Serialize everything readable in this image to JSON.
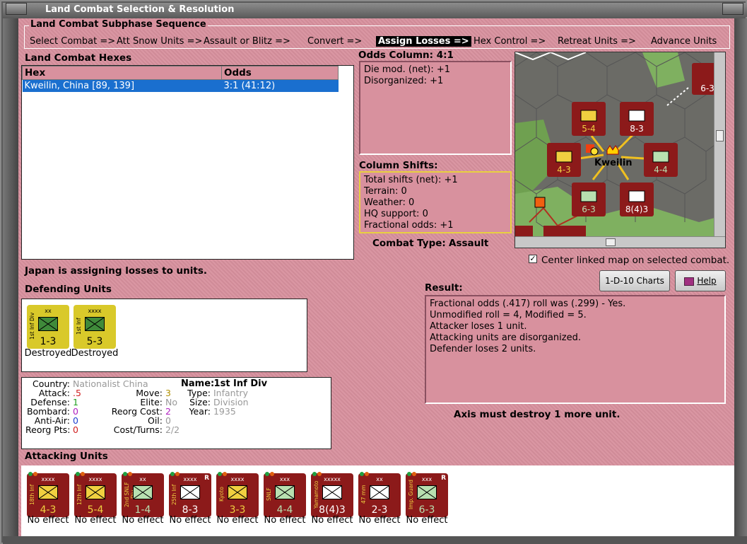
{
  "window": {
    "title": "Land Combat Selection & Resolution"
  },
  "sequence": {
    "label": "Land Combat Subphase Sequence",
    "steps": [
      "Select Combat =>",
      "Att Snow Units =>",
      "Assault or Blitz =>",
      "Convert =>",
      "Assign Losses =>",
      "Hex Control =>",
      "Retreat Units =>",
      "Advance Units"
    ],
    "active_index": 4
  },
  "hexes": {
    "label": "Land Combat Hexes",
    "columns": [
      "Hex",
      "Odds"
    ],
    "rows": [
      {
        "hex": "Kweilin, China [89, 139]",
        "odds": "3:1 (41:12)"
      }
    ]
  },
  "odds_column": {
    "label": "Odds Column: 4:1",
    "lines": [
      "Die mod. (net): +1",
      "Disorganized: +1"
    ]
  },
  "column_shifts": {
    "label": "Column Shifts:",
    "lines": [
      "Total shifts (net): +1",
      "Terrain: 0",
      "Weather: 0",
      "HQ support: 0",
      "Fractional odds: +1"
    ]
  },
  "combat_type": {
    "label": "Combat Type:",
    "value": "Assault"
  },
  "map": {
    "city": "Kweilin",
    "center_checkbox": {
      "label": "Center linked map on selected combat.",
      "checked": true
    }
  },
  "status_msg": "Japan is assigning losses to units.",
  "defending": {
    "label": "Defending Units",
    "units": [
      {
        "name": "1st Inf Div",
        "size": "xx",
        "strength": "1-3",
        "caption": "Destroyed",
        "bg": "#d9c92a",
        "box": "#3f8a3a"
      },
      {
        "name": "1st Inf",
        "size": "xxxx",
        "strength": "5-3",
        "caption": "Destroyed",
        "bg": "#d9c92a",
        "box": "#3f8a3a"
      }
    ]
  },
  "unit_info": {
    "country_k": "Country:",
    "country": "Nationalist China",
    "attack_k": "Attack:",
    "attack": ".5",
    "defense_k": "Defense:",
    "defense": "1",
    "bombard_k": "Bombard:",
    "bombard": "0",
    "antiair_k": "Anti-Air:",
    "antiair": "0",
    "reorgpts_k": "Reorg Pts:",
    "reorgpts": "0",
    "move_k": "Move:",
    "move": "3",
    "elite_k": "Elite:",
    "elite": "No",
    "reorgcost_k": "Reorg Cost:",
    "reorgcost": "2",
    "oil_k": "Oil:",
    "oil": "0",
    "costturns_k": "Cost/Turns:",
    "costturns": "2/2",
    "name_k": "Name:",
    "name": "1st Inf Div",
    "type_k": "Type:",
    "type": "Infantry",
    "size_k": "Size:",
    "size": "Division",
    "year_k": "Year:",
    "year": "1935"
  },
  "buttons": {
    "charts": "1-D-10 Charts",
    "help": "Help"
  },
  "result": {
    "label": "Result:",
    "lines": [
      "Fractional odds (.417) roll was (.299)  - Yes.",
      "Unmodified roll = 4, Modified = 5.",
      "Attacker loses 1 unit.",
      "Attacking units are disorganized.",
      "Defender loses 2 units."
    ],
    "footer": "Axis must destroy 1 more unit."
  },
  "attacking": {
    "label": "Attacking Units",
    "units": [
      {
        "name": "18th Inf",
        "size": "xxxx",
        "strength": "4-3",
        "caption": "No effect",
        "boxcolor": "#f0d040",
        "r": ""
      },
      {
        "name": "12th Inf",
        "size": "xxxx",
        "strength": "5-4",
        "caption": "No effect",
        "boxcolor": "#f0d040",
        "r": ""
      },
      {
        "name": "2nd SNLF Div",
        "size": "xx",
        "strength": "1-4",
        "caption": "No effect",
        "boxcolor": "#b8e0b0",
        "r": ""
      },
      {
        "name": "25th Inf",
        "size": "xxxx",
        "strength": "8-3",
        "caption": "No effect",
        "boxcolor": "#ffffff",
        "r": "R"
      },
      {
        "name": "Kyoto",
        "size": "xxxx",
        "strength": "3-3",
        "caption": "No effect",
        "boxcolor": "#f0d040",
        "r": ""
      },
      {
        "name": "SNLF",
        "size": "xxx",
        "strength": "4-4",
        "caption": "No effect",
        "boxcolor": "#b8e0b0",
        "r": ""
      },
      {
        "name": "Yamamoto",
        "size": "xxxxx",
        "strength": "8(4)3",
        "caption": "No effect",
        "boxcolor": "#ffffff",
        "r": ""
      },
      {
        "name": "47 mm",
        "size": "xx",
        "strength": "2-3",
        "caption": "No effect",
        "boxcolor": "#ffffff",
        "r": ""
      },
      {
        "name": "Imp. Guard",
        "size": "xxx",
        "strength": "6-3",
        "caption": "No effect",
        "boxcolor": "#b8e0b0",
        "r": "R"
      }
    ]
  },
  "colors": {
    "pink": "#d8919e",
    "counter_red": "#8c1a1a",
    "selection": "#1a6fcf"
  }
}
